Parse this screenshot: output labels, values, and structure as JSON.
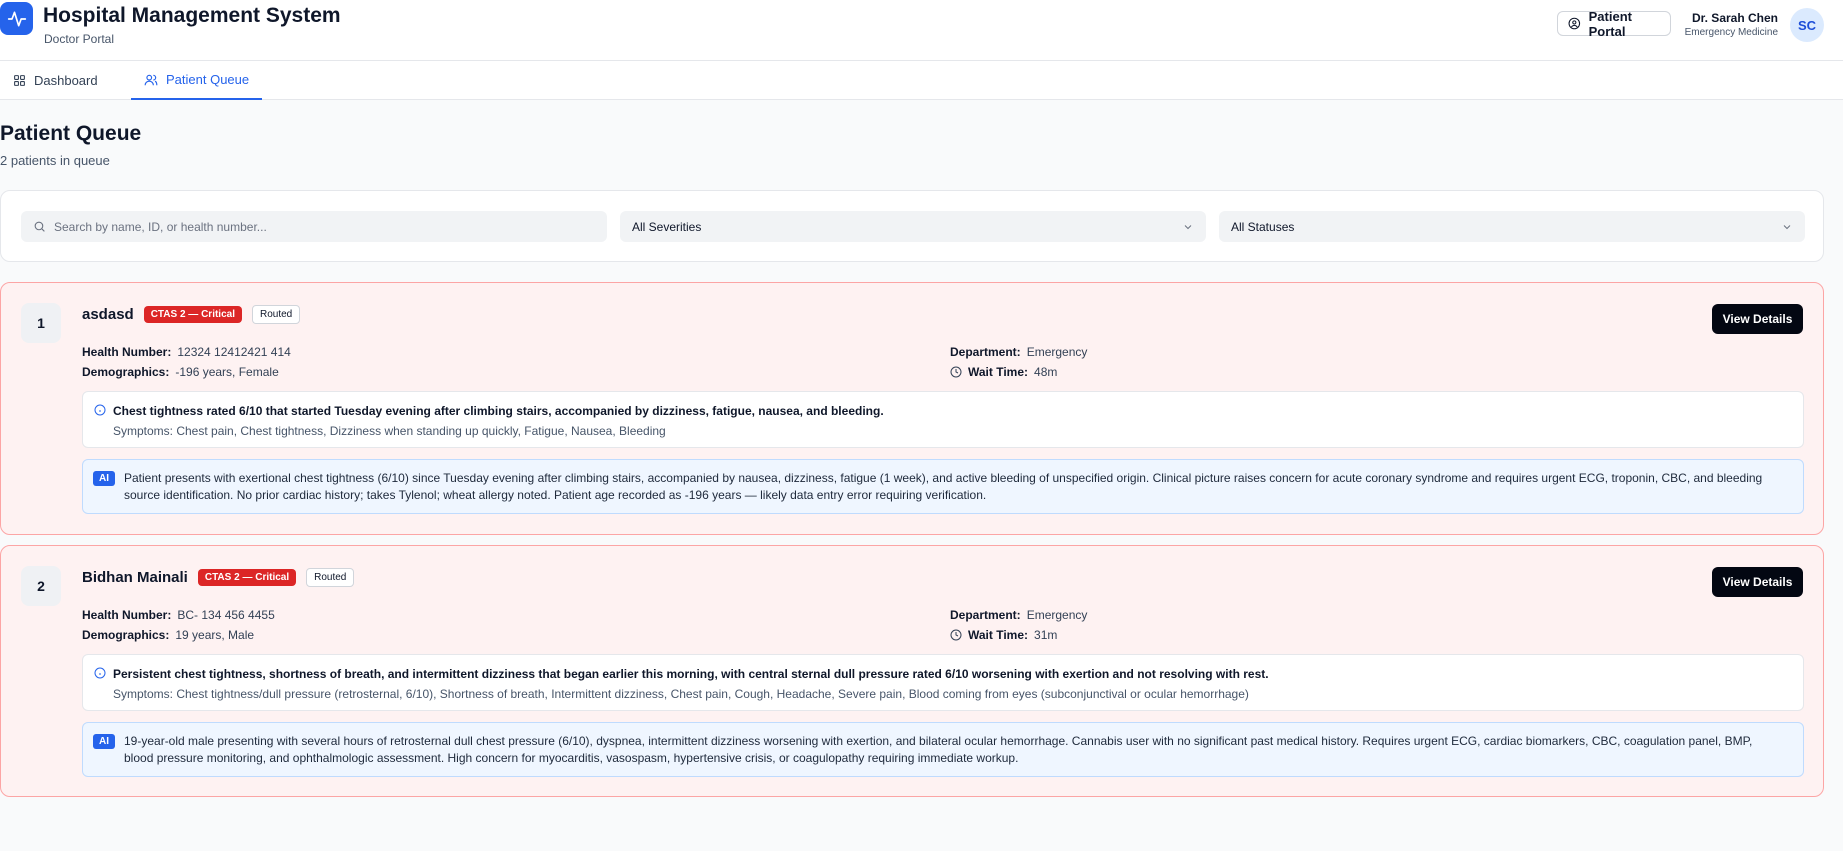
{
  "header": {
    "title": "Hospital Management System",
    "subtitle": "Doctor Portal",
    "patient_portal_label": "Patient Portal",
    "doctor_name": "Dr. Sarah Chen",
    "doctor_specialty": "Emergency Medicine",
    "avatar_initials": "SC"
  },
  "tabs": [
    {
      "label": "Dashboard",
      "icon": "grid-icon",
      "active": false
    },
    {
      "label": "Patient Queue",
      "icon": "users-icon",
      "active": true
    }
  ],
  "page": {
    "title": "Patient Queue",
    "subtitle": "2 patients in queue"
  },
  "filters": {
    "search_placeholder": "Search by name, ID, or health number...",
    "search_value": "",
    "severity_selected": "All Severities",
    "status_selected": "All Statuses"
  },
  "labels": {
    "health_number": "Health Number:",
    "demographics": "Demographics:",
    "department": "Department:",
    "wait_time": "Wait Time:",
    "view_details": "View Details",
    "ai": "AI"
  },
  "patients": [
    {
      "number": "1",
      "name": "asdasd",
      "severity": "CTAS 2 — Critical",
      "status": "Routed",
      "health_number": "12324 12412421 414",
      "demographics": "-196 years, Female",
      "department": "Emergency",
      "wait_time": "48m",
      "complaint": "Chest tightness rated 6/10 that started Tuesday evening after climbing stairs, accompanied by dizziness, fatigue, nausea, and bleeding.",
      "symptoms": "Symptoms: Chest pain, Chest tightness, Dizziness when standing up quickly, Fatigue, Nausea, Bleeding",
      "ai_summary": "Patient presents with exertional chest tightness (6/10) since Tuesday evening after climbing stairs, accompanied by nausea, dizziness, fatigue (1 week), and active bleeding of unspecified origin. Clinical picture raises concern for acute coronary syndrome and requires urgent ECG, troponin, CBC, and bleeding source identification. No prior cardiac history; takes Tylenol; wheat allergy noted. Patient age recorded as -196 years — likely data entry error requiring verification."
    },
    {
      "number": "2",
      "name": "Bidhan Mainali",
      "severity": "CTAS 2 — Critical",
      "status": "Routed",
      "health_number": "BC- 134 456 4455",
      "demographics": "19 years, Male",
      "department": "Emergency",
      "wait_time": "31m",
      "complaint": "Persistent chest tightness, shortness of breath, and intermittent dizziness that began earlier this morning, with central sternal dull pressure rated 6/10 worsening with exertion and not resolving with rest.",
      "symptoms": "Symptoms: Chest tightness/dull pressure (retrosternal, 6/10), Shortness of breath, Intermittent dizziness, Chest pain, Cough, Headache, Severe pain, Blood coming from eyes (subconjunctival or ocular hemorrhage)",
      "ai_summary": "19-year-old male presenting with several hours of retrosternal dull chest pressure (6/10), dyspnea, intermittent dizziness worsening with exertion, and bilateral ocular hemorrhage. Cannabis user with no significant past medical history. Requires urgent ECG, cardiac biomarkers, CBC, coagulation panel, BMP, blood pressure monitoring, and ophthalmologic assessment. High concern for myocarditis, vasospasm, hypertensive crisis, or coagulopathy requiring immediate workup."
    }
  ],
  "colors": {
    "brand": "#2563eb",
    "critical": "#dc2626",
    "card_bg": "#fef2f2",
    "card_border": "#fca5a5"
  }
}
